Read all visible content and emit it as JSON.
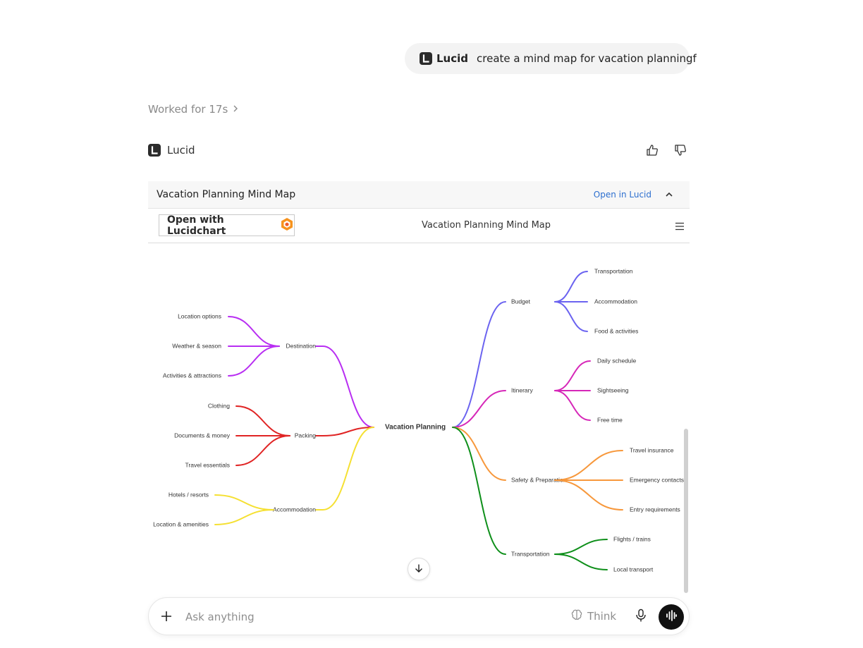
{
  "user_message": {
    "app_name": "Lucid",
    "text": "create a mind map for vacation planningf"
  },
  "worked_status": "Worked for 17s",
  "assistant": {
    "name": "Lucid"
  },
  "embed": {
    "title": "Vacation Planning Mind Map",
    "open_link": "Open in Lucid",
    "open_with_button": "Open with Lucidchart",
    "doc_title": "Vacation Planning Mind Map"
  },
  "mind_map": {
    "root": "Vacation Planning",
    "colors": {
      "destination": "#b82ef2",
      "packing": "#e02424",
      "accommodation": "#f5e032",
      "budget": "#6b63f0",
      "itinerary": "#d627b8",
      "safety": "#f7983c",
      "transportation": "#0e8f1a"
    },
    "branches": [
      {
        "label": "Destination",
        "color_key": "destination",
        "children": [
          "Location options",
          "Weather & season",
          "Activities & attractions"
        ]
      },
      {
        "label": "Packing",
        "color_key": "packing",
        "children": [
          "Clothing",
          "Documents & money",
          "Travel essentials"
        ]
      },
      {
        "label": "Accommodation",
        "color_key": "accommodation",
        "children": [
          "Hotels / resorts",
          "Location & amenities"
        ]
      },
      {
        "label": "Budget",
        "color_key": "budget",
        "children": [
          "Transportation",
          "Accommodation",
          "Food & activities"
        ]
      },
      {
        "label": "Itinerary",
        "color_key": "itinerary",
        "children": [
          "Daily schedule",
          "Sightseeing",
          "Free time"
        ]
      },
      {
        "label": "Safety & Preparation",
        "color_key": "safety",
        "children": [
          "Travel insurance",
          "Emergency contacts",
          "Entry requirements"
        ]
      },
      {
        "label": "Transportation",
        "color_key": "transportation",
        "children": [
          "Flights / trains",
          "Local transport"
        ]
      }
    ]
  },
  "composer": {
    "placeholder": "Ask anything",
    "think_label": "Think"
  }
}
